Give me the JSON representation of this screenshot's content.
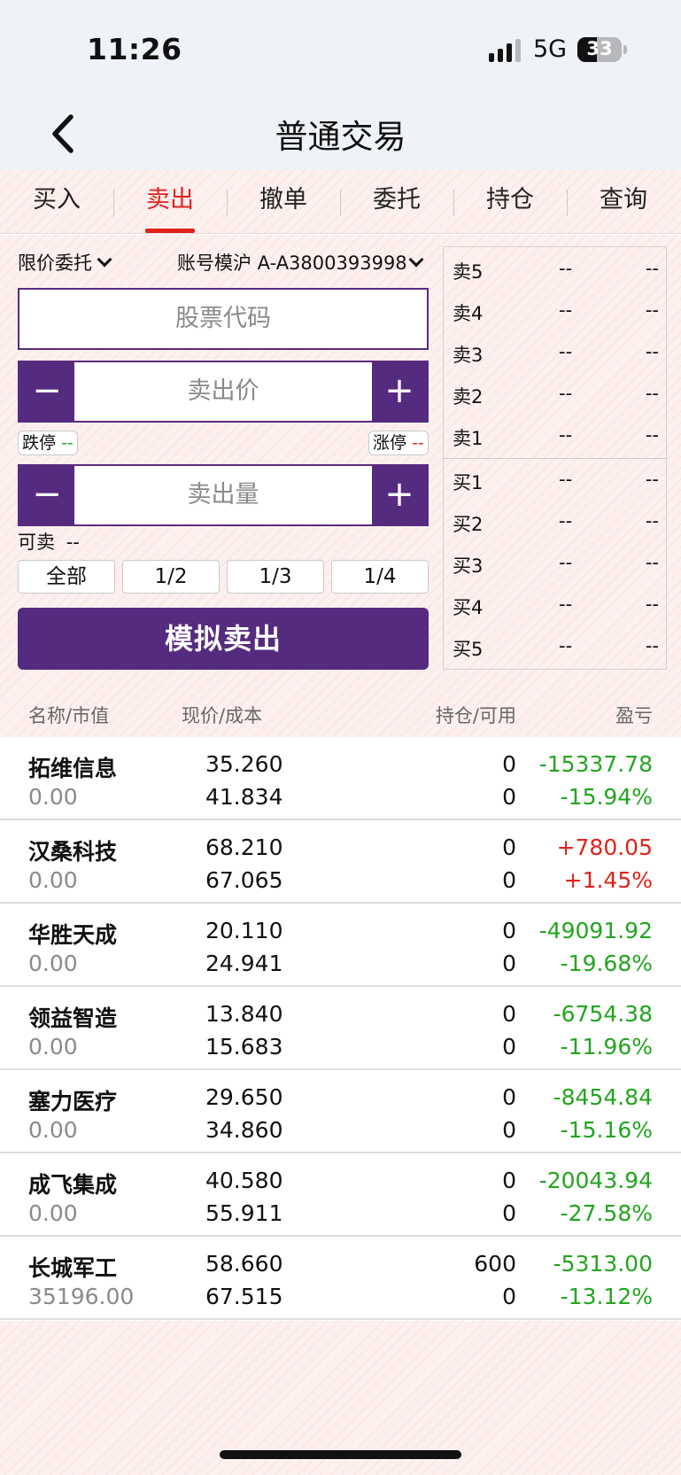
{
  "status": {
    "time": "11:26",
    "network": "5G",
    "battery": "33"
  },
  "nav": {
    "title": "普通交易"
  },
  "tabs": [
    "买入",
    "卖出",
    "撤单",
    "委托",
    "持仓",
    "查询"
  ],
  "form": {
    "order_type": "限价委托",
    "account": "账号模沪 A-A3800393998",
    "code_placeholder": "股票代码",
    "price_placeholder": "卖出价",
    "qty_placeholder": "卖出量",
    "limit_down_label": "跌停",
    "limit_down_value": "--",
    "limit_up_label": "涨停",
    "limit_up_value": "--",
    "sellable_label": "可卖",
    "sellable_value": "--",
    "ratios": [
      "全部",
      "1/2",
      "1/3",
      "1/4"
    ],
    "submit": "模拟卖出",
    "minus": "−",
    "plus": "+"
  },
  "book": {
    "asks": [
      {
        "label": "卖5",
        "price": "--",
        "vol": "--"
      },
      {
        "label": "卖4",
        "price": "--",
        "vol": "--"
      },
      {
        "label": "卖3",
        "price": "--",
        "vol": "--"
      },
      {
        "label": "卖2",
        "price": "--",
        "vol": "--"
      },
      {
        "label": "卖1",
        "price": "--",
        "vol": "--"
      }
    ],
    "bids": [
      {
        "label": "买1",
        "price": "--",
        "vol": "--"
      },
      {
        "label": "买2",
        "price": "--",
        "vol": "--"
      },
      {
        "label": "买3",
        "price": "--",
        "vol": "--"
      },
      {
        "label": "买4",
        "price": "--",
        "vol": "--"
      },
      {
        "label": "买5",
        "price": "--",
        "vol": "--"
      }
    ]
  },
  "positions": {
    "headers": {
      "name": "名称/市值",
      "price": "现价/成本",
      "hold": "持仓/可用",
      "pnl": "盈亏"
    },
    "rows": [
      {
        "name": "拓维信息",
        "market_value": "0.00",
        "price": "35.260",
        "cost": "41.834",
        "hold": "0",
        "avail": "0",
        "pnl": "-15337.78",
        "pct": "-15.94%",
        "dir": "down"
      },
      {
        "name": "汉桑科技",
        "market_value": "0.00",
        "price": "68.210",
        "cost": "67.065",
        "hold": "0",
        "avail": "0",
        "pnl": "+780.05",
        "pct": "+1.45%",
        "dir": "up"
      },
      {
        "name": "华胜天成",
        "market_value": "0.00",
        "price": "20.110",
        "cost": "24.941",
        "hold": "0",
        "avail": "0",
        "pnl": "-49091.92",
        "pct": "-19.68%",
        "dir": "down"
      },
      {
        "name": "领益智造",
        "market_value": "0.00",
        "price": "13.840",
        "cost": "15.683",
        "hold": "0",
        "avail": "0",
        "pnl": "-6754.38",
        "pct": "-11.96%",
        "dir": "down"
      },
      {
        "name": "塞力医疗",
        "market_value": "0.00",
        "price": "29.650",
        "cost": "34.860",
        "hold": "0",
        "avail": "0",
        "pnl": "-8454.84",
        "pct": "-15.16%",
        "dir": "down"
      },
      {
        "name": "成飞集成",
        "market_value": "0.00",
        "price": "40.580",
        "cost": "55.911",
        "hold": "0",
        "avail": "0",
        "pnl": "-20043.94",
        "pct": "-27.58%",
        "dir": "down"
      },
      {
        "name": "长城军工",
        "market_value": "35196.00",
        "price": "58.660",
        "cost": "67.515",
        "hold": "600",
        "avail": "0",
        "pnl": "-5313.00",
        "pct": "-13.12%",
        "dir": "down"
      }
    ]
  },
  "colors": {
    "accent": "#552b7f",
    "up": "#e0221b",
    "down": "#22a51f",
    "active_tab": "#e0221b"
  },
  "icons": {
    "back": "chevron-left-icon",
    "dropdown": "chevron-down-icon",
    "signal": "cellular-signal-icon",
    "battery": "battery-icon"
  }
}
